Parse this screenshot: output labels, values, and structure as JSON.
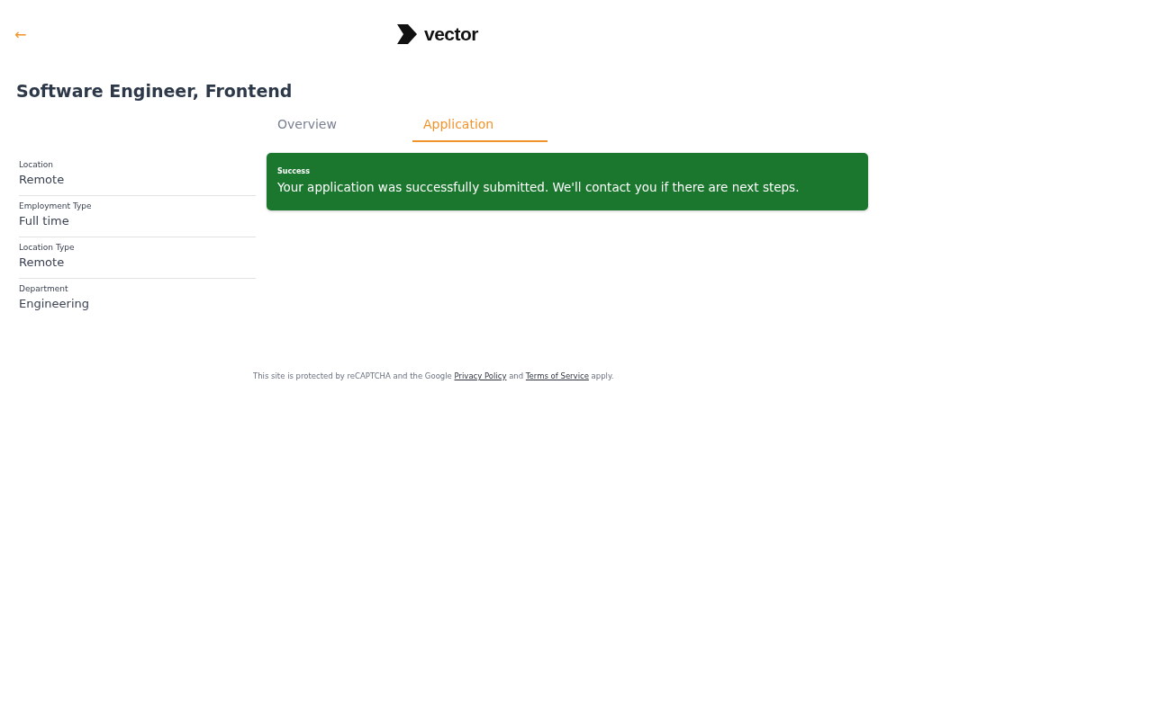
{
  "header": {
    "back_icon": "←",
    "logo_text": "vector"
  },
  "title": "Software Engineer, Frontend",
  "tabs": [
    {
      "label": "Overview",
      "selected": false
    },
    {
      "label": "Application",
      "selected": true
    }
  ],
  "details": [
    {
      "label": "Location",
      "value": "Remote"
    },
    {
      "label": "Employment Type",
      "value": "Full time"
    },
    {
      "label": "Location Type",
      "value": "Remote"
    },
    {
      "label": "Department",
      "value": "Engineering"
    }
  ],
  "alert": {
    "kind": "success",
    "title": "Success",
    "message": "Your application was successfully submitted. We'll contact you if there are next steps."
  },
  "footer": {
    "before": "This site is protected by reCAPTCHA and the Google",
    "link_1": "Privacy Policy",
    "middle": "and",
    "link_2": "Terms of Service",
    "after": "apply."
  }
}
